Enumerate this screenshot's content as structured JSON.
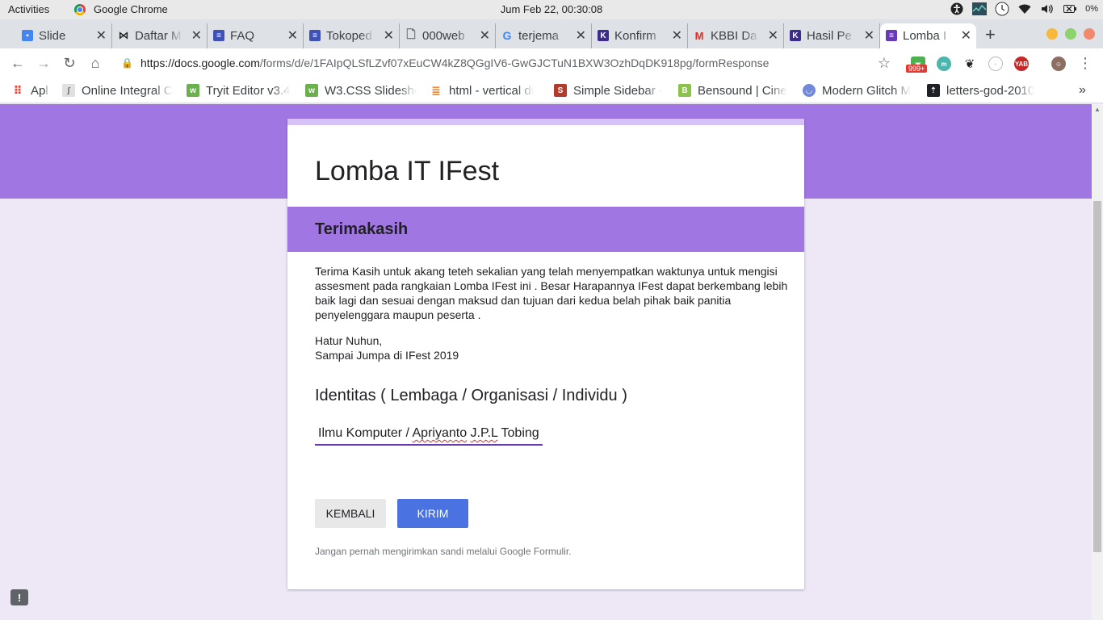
{
  "system_bar": {
    "activities": "Activities",
    "app_name": "Google Chrome",
    "clock": "Jum Feb 22, 00:30:08",
    "battery": "0%"
  },
  "tabs": [
    {
      "title": "Slide",
      "icon": "slides-icon",
      "color": "#4285f4"
    },
    {
      "title": "Daftar M",
      "icon": "bowtie-icon",
      "color": "#222222"
    },
    {
      "title": "FAQ",
      "icon": "forms-icon",
      "color": "#3f51b5"
    },
    {
      "title": "Tokoped",
      "icon": "forms-icon",
      "color": "#3f51b5"
    },
    {
      "title": "000web",
      "icon": "page-icon",
      "color": "#5f6368"
    },
    {
      "title": "terjema",
      "icon": "google-icon",
      "color": "#4285f4"
    },
    {
      "title": "Konfirm",
      "icon": "k-icon",
      "color": "#3d2c8d"
    },
    {
      "title": "KBBI Da",
      "icon": "gmail-icon",
      "color": "#d93025"
    },
    {
      "title": "Hasil Pe",
      "icon": "k-icon",
      "color": "#3d2c8d"
    },
    {
      "title": "Lomba I",
      "icon": "forms-icon",
      "color": "#673ab7",
      "active": true
    }
  ],
  "toolbar": {
    "url_host": "https://docs.google.com",
    "url_path": "/forms/d/e/1FAIpQLSfLZvf07xEuCW4kZ8QGgIV6-GwGJCTuN1BXW3OzhDqDK918pg/formResponse",
    "badge": "999+"
  },
  "bookmarks": [
    {
      "label": "Apl",
      "icon": "apps-grid-icon",
      "color": "#ea4335"
    },
    {
      "label": "Online Integral C",
      "icon": "integral-icon",
      "color": "#9e9e9e"
    },
    {
      "label": "Tryit Editor v3.4",
      "icon": "w3-icon",
      "color": "#6ab04c"
    },
    {
      "label": "W3.CSS Slidesho",
      "icon": "w3-icon",
      "color": "#6ab04c"
    },
    {
      "label": "html - vertical di",
      "icon": "stackoverflow-icon",
      "color": "#f48024"
    },
    {
      "label": "Simple Sidebar -",
      "icon": "s-icon",
      "color": "#b23b2e"
    },
    {
      "label": "Bensound | Cine",
      "icon": "b-icon",
      "color": "#8bc34a"
    },
    {
      "label": "Modern Glitch M",
      "icon": "discord-icon",
      "color": "#7289da"
    },
    {
      "label": "letters-god-2010",
      "icon": "upload-icon",
      "color": "#202124"
    }
  ],
  "form": {
    "title": "Lomba IT IFest",
    "section_title": "Terimakasih",
    "description": "Terima Kasih untuk akang teteh sekalian yang telah menyempatkan waktunya untuk mengisi assesment pada rangkaian Lomba IFest ini . Besar Harapannya IFest dapat berkembang lebih baik lagi dan sesuai dengan maksud dan tujuan dari kedua belah pihak baik panitia penyelenggara maupun peserta .",
    "sign_line1": "Hatur Nuhun,",
    "sign_line2": "Sampai Jumpa di IFest 2019",
    "question": "Identitas ( Lembaga / Organisasi / Individu )",
    "answer_part1": "Ilmu Komputer / ",
    "answer_part2": "Apriyanto",
    "answer_part3": " ",
    "answer_part4": "J.P.L",
    "answer_part5": " Tobing",
    "back_label": "KEMBALI",
    "send_label": "KIRIM",
    "footnote": "Jangan pernah mengirimkan sandi melalui Google Formulir.",
    "accent_color": "#a076e2"
  }
}
